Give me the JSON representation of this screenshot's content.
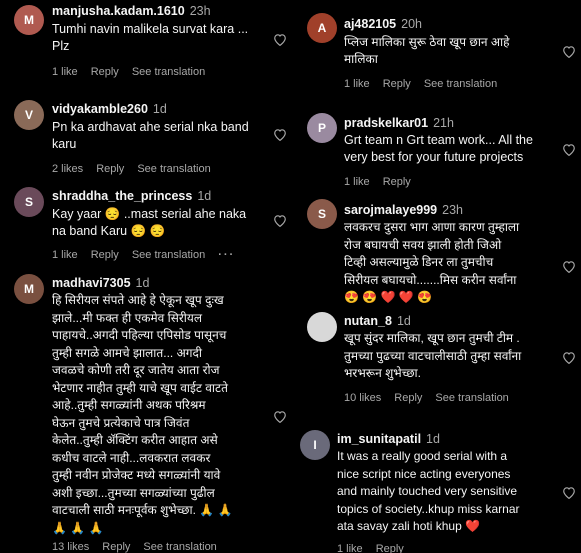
{
  "left": [
    {
      "user": "manjusha.kadam.1610",
      "ago": "23h",
      "lines": [
        "Tumhi navin malikela survat kara ...",
        "Plz"
      ],
      "likes": "1 like",
      "reply": "Reply",
      "see": "See translation",
      "more": false,
      "avatar_color": "#b05a50",
      "avatar_letter": "M"
    },
    {
      "user": "vidyakamble260",
      "ago": "1d",
      "lines": [
        "Pn ka ardhavat ahe serial nka band",
        "karu"
      ],
      "likes": "2 likes",
      "reply": "Reply",
      "see": "See translation",
      "more": false,
      "avatar_color": "#8a6a58",
      "avatar_letter": "V"
    },
    {
      "user": "shraddha_the_princess",
      "ago": "1d",
      "lines": [
        "Kay yaar 😔 ..mast serial ahe naka",
        "na band Karu 😔 😔"
      ],
      "likes": "1 like",
      "reply": "Reply",
      "see": "See translation",
      "more": true,
      "avatar_color": "#6a4a5a",
      "avatar_letter": "S"
    },
    {
      "user": "madhavi7305",
      "ago": "1d",
      "lines": [
        "हि सिरीयल संपते आहे हे ऐकून खूप दुःख",
        "झाले...मी फक्त ही एकमेव सिरीयल",
        "पाहायचे..अगदी पहिल्या एपिसोड पासूनच",
        "तुम्ही सगळे आमचे झालात... अगदी",
        "जवळचे कोणी तरी दूर जातेय आता रोज",
        "भेटणार नाहीत तुम्ही याचे खूप वाईट वाटते",
        "आहे..तुम्ही सगळ्यांनी अथक परिश्रम",
        "घेऊन तुमचे प्रत्येकाचे पात्र जिवंत",
        "केलेत..तुम्ही ॲक्टिंग करीत आहात असे",
        "कधीच वाटले नाही...लवकरात लवकर",
        "तुम्ही नवीन प्रोजेक्ट मध्ये सगळ्यांनी यावे",
        "अशी इच्छा...तुमच्या सगळ्यांच्या पुढील",
        "वाटचाली साठी मनःपूर्वक शुभेच्छा. 🙏 🙏",
        "🙏 🙏 🙏"
      ],
      "likes": "13 likes",
      "reply": "Reply",
      "see": "See translation",
      "more": false,
      "avatar_color": "#7a5040",
      "avatar_letter": "M"
    }
  ],
  "right": [
    {
      "user": "aj482105",
      "ago": "20h",
      "lines": [
        "प्लिज मालिका सुरू ठेवा खूप छान आहे",
        "मालिका"
      ],
      "likes": "1 like",
      "reply": "Reply",
      "see": "See translation",
      "more": false,
      "avatar_color": "#a0402a",
      "avatar_letter": "A"
    },
    {
      "user": "pradskelkar01",
      "ago": "21h",
      "lines": [
        "Grt team n Grt team work... All the",
        "very best for your future projects"
      ],
      "likes": "1 like",
      "reply": "Reply",
      "see": "",
      "more": false,
      "avatar_color": "#9a8aa0",
      "avatar_letter": "P"
    },
    {
      "user": "sarojmalaye999",
      "ago": "23h",
      "lines": [
        "लवकरच दुसरा भाग आणा कारण तुम्हाला",
        "रोज बघायची सवय झाली होती जिओ",
        "टिव्ही असल्यामुळे डिनर ला तुमचीच",
        "सिरीयल बघायचो.......मिस करीन सर्वांना",
        "😍 😍 ❤️ ❤️ 😍"
      ],
      "likes": "",
      "reply": "",
      "see": "",
      "more": false,
      "avatar_color": "#8a5a4a",
      "avatar_letter": "S"
    },
    {
      "user": "nutan_8",
      "ago": "1d",
      "lines": [
        "खूप सुंदर मालिका, खूप छान तुमची टीम .",
        "तुमच्या पुढच्या वाटचालीसाठी तुम्हा सर्वांना",
        "भरभरून शुभेच्छा."
      ],
      "likes": "10 likes",
      "reply": "Reply",
      "see": "See translation",
      "more": false,
      "avatar_color": "#d8d8d8",
      "avatar_letter": ""
    },
    {
      "user": "im_sunitapatil",
      "ago": "1d",
      "lines": [
        "It was a really good serial with a",
        "nice script nice acting everyones",
        "and mainly touched very sensitive",
        "topics of society..khup miss karnar",
        "ata savay zali hoti khup ❤️"
      ],
      "likes": "1 like",
      "reply": "Reply",
      "see": "",
      "more": false,
      "avatar_color": "#6a6a7a",
      "avatar_letter": "I"
    }
  ]
}
